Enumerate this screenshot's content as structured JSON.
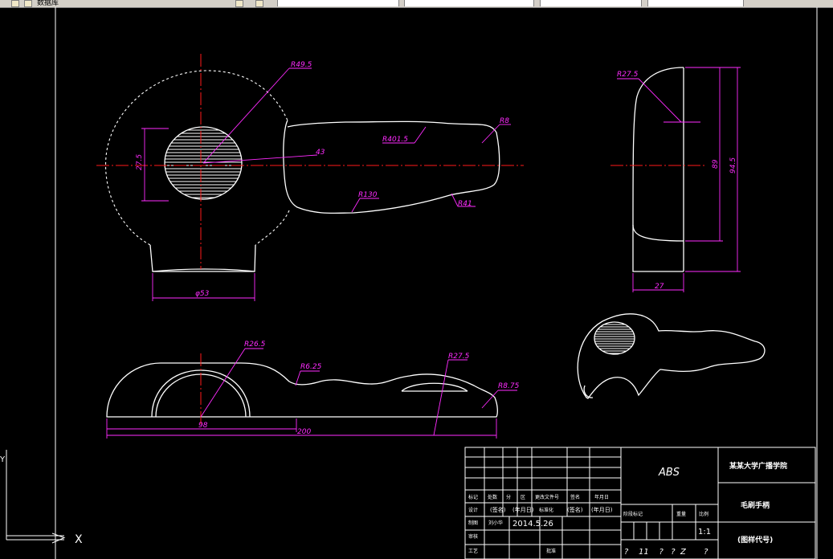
{
  "toolbar": {
    "label": "数据库"
  },
  "dimensions": {
    "r_big": "R49.5",
    "d_275": "27.5",
    "d_43": "43",
    "r_4015": "R401.5",
    "r_8": "R8",
    "r_130": "R130",
    "r_41": "R41",
    "phi_53": "φ53",
    "r_275_side": "R27.5",
    "d_89": "89",
    "d_945": "94.5",
    "d_27": "27",
    "r_265": "R26.5",
    "r_625": "R6.25",
    "r_275_bottom": "R27.5",
    "r_875": "R8.75",
    "d_98": "98",
    "d_200": "200"
  },
  "title_block": {
    "material": "ABS",
    "school": "某某大学广播学院",
    "part_name": "毛刷手柄",
    "drawing_no": "(图样代号)",
    "row_headers": [
      "标记",
      "处数",
      "分",
      "区",
      "更改文件号",
      "签名",
      "年月日"
    ],
    "design": "设计",
    "design_sign": "(签名)",
    "design_date": "(年月日)",
    "std": "标准化",
    "std_sign": "(签名)",
    "std_date": "(年月日)",
    "drawn": "制图",
    "drawn_name": "刘小华",
    "date": "2014.5.26",
    "check": "审核",
    "process": "工艺",
    "approve": "批准",
    "stage_label": "阶段标记",
    "weight_label": "重量",
    "scale_label": "比例",
    "scale": "1:1",
    "sheets_row": "?    11    ?   ?  Z       ?"
  },
  "ucs": {
    "x_label": "X",
    "y_label": "Y"
  },
  "colors": {
    "background": "#000000",
    "geometry": "#ffffff",
    "center_line": "#ff1a1a",
    "dimension": "#ff2bff"
  }
}
